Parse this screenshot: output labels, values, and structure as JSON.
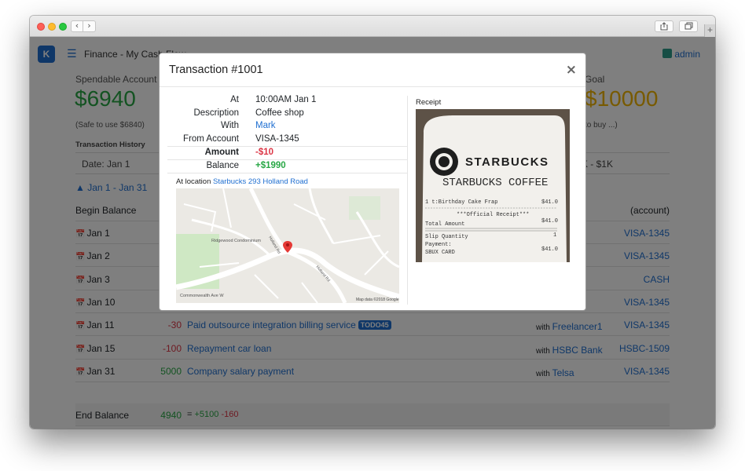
{
  "browser": {
    "back": "‹",
    "forward": "›"
  },
  "app": {
    "logo_letter": "K",
    "title": "Finance - My Cash Flow",
    "user": "admin"
  },
  "spendable": {
    "label": "Spendable Account",
    "value": "$6940",
    "note": "(Safe to use $6840)"
  },
  "goal": {
    "label": "Goal",
    "value": "$10000",
    "note": "to buy ...)"
  },
  "history": {
    "title": "Transaction History",
    "date_filter": "Date: Jan 1",
    "range_filter": "K - $1K",
    "period": "▲ Jan 1 - Jan 31",
    "account_header": "(account)",
    "begin_label": "Begin Balance",
    "rows": [
      {
        "date": "Jan 1",
        "amount": "",
        "desc": "",
        "badge": "",
        "with_prefix": "",
        "with": "",
        "account": "VISA-1345"
      },
      {
        "date": "Jan 2",
        "amount": "",
        "desc": "",
        "badge": "",
        "with_prefix": "",
        "with": "",
        "account": "VISA-1345"
      },
      {
        "date": "Jan 3",
        "amount": "",
        "desc": "",
        "badge": "",
        "with_prefix": "",
        "with": "",
        "account": "CASH"
      },
      {
        "date": "Jan 10",
        "amount": "",
        "desc": "",
        "badge": "",
        "with_prefix": "",
        "with": "",
        "account": "VISA-1345"
      },
      {
        "date": "Jan 11",
        "amount": "-30",
        "desc": "Paid outsource integration billing service",
        "badge": "TODO45",
        "with_prefix": "with",
        "with": "Freelancer1",
        "account": "VISA-1345"
      },
      {
        "date": "Jan 15",
        "amount": "-100",
        "desc": "Repayment car loan",
        "badge": "",
        "with_prefix": "with",
        "with": "HSBC Bank",
        "account": "HSBC-1509"
      },
      {
        "date": "Jan 31",
        "amount": "5000",
        "desc": "Company salary payment",
        "badge": "",
        "with_prefix": "with",
        "with": "Telsa",
        "account": "VISA-1345"
      }
    ],
    "end": {
      "label": "End Balance",
      "amount": "4940",
      "eq": "=",
      "plus": "+5100",
      "minus": "-160"
    }
  },
  "modal": {
    "title": "Transaction #1001",
    "close": "×",
    "fields": [
      {
        "key": "At",
        "value": "10:00AM Jan 1"
      },
      {
        "key": "Description",
        "value": "Coffee shop"
      },
      {
        "key": "With",
        "value": "Mark"
      },
      {
        "key": "From Account",
        "value": "VISA-1345"
      },
      {
        "key": "Amount",
        "value": "-$10"
      },
      {
        "key": "Balance",
        "value": "+$1990"
      }
    ],
    "location_prefix": "At location",
    "location_link": "Starbucks 293 Holland Road",
    "map": {
      "labels": [
        "Ridgewood Condominium",
        "Holland Rd",
        "Commonwealth Ave W",
        "Holland Rd"
      ],
      "credit": "Map data ©2018 Google"
    },
    "receipt_label": "Receipt",
    "receipt": {
      "brand": "STARBUCKS",
      "headline": "STARBUCKS COFFEE",
      "lines": [
        {
          "left": "1  t:Birthday Cake Frap",
          "right": "$41.0"
        },
        {
          "left": "***Official Receipt***",
          "right": ""
        },
        {
          "left": "Total Amount",
          "right": "$41.0"
        },
        {
          "left": "Slip Quantity",
          "right": "1"
        },
        {
          "left": "Payment:",
          "right": ""
        },
        {
          "left": "SBUX CARD",
          "right": "$41.0"
        }
      ]
    }
  }
}
